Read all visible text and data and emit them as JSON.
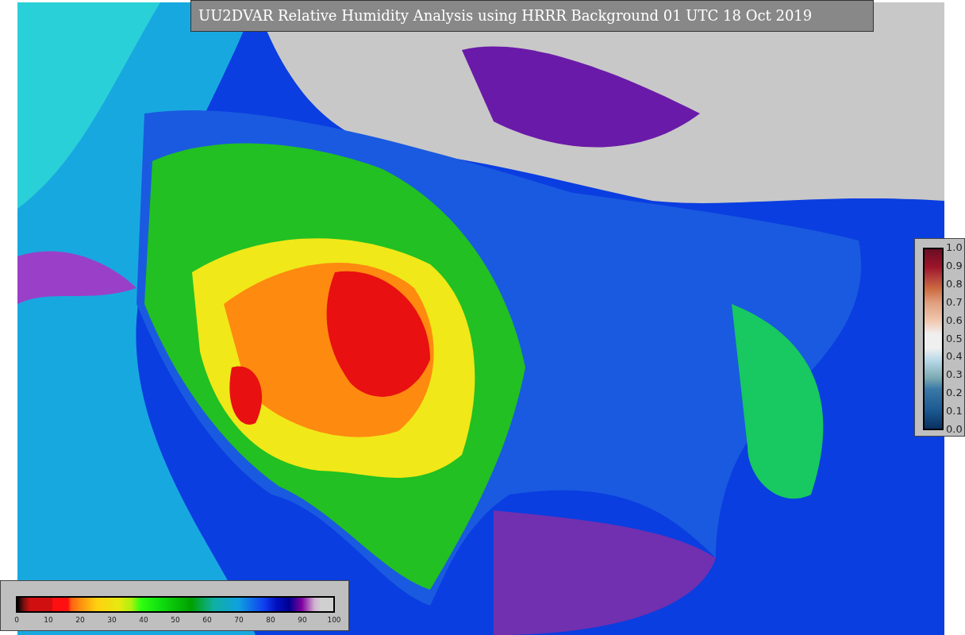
{
  "title": "UU2DVAR Relative Humidity Analysis using HRRR Background 01 UTC 18 Oct 2019",
  "humidity_colorbar": {
    "ticks": [
      "0",
      "10",
      "20",
      "30",
      "40",
      "50",
      "60",
      "70",
      "80",
      "90",
      "100"
    ]
  },
  "innovation_colorbar": {
    "ticks": [
      "1.0",
      "0.9",
      "0.8",
      "0.7",
      "0.6",
      "0.5",
      "0.4",
      "0.3",
      "0.2",
      "0.1",
      "0.0"
    ]
  }
}
